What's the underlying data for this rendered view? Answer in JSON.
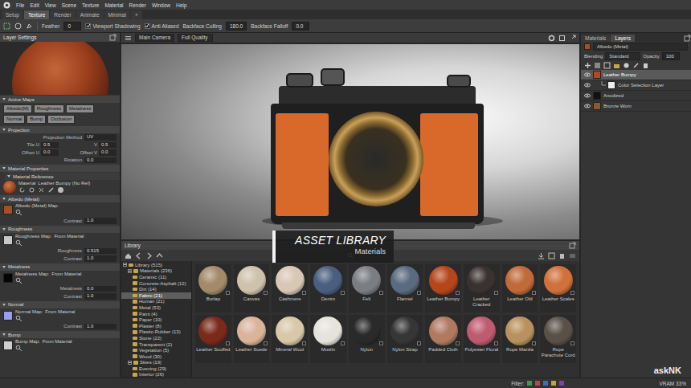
{
  "menu": [
    "File",
    "Edit",
    "View",
    "Scene",
    "Texture",
    "Material",
    "Render",
    "Window",
    "Help"
  ],
  "tabs": [
    {
      "label": "Setup",
      "selected": false
    },
    {
      "label": "Texture",
      "selected": true
    },
    {
      "label": "Render",
      "selected": false
    },
    {
      "label": "Animate",
      "selected": false
    },
    {
      "label": "Minimal",
      "selected": false
    }
  ],
  "tab_add": "+",
  "toolbar": {
    "feather_label": "Feather",
    "feather_value": "0",
    "checks": [
      {
        "label": "Viewport Shadowing",
        "checked": true
      },
      {
        "label": "Anti Aliased",
        "checked": true
      }
    ],
    "culling_label": "Backface Culling",
    "culling_value": "180.0",
    "falloff_label": "Backface Falloff",
    "falloff_value": "0.0"
  },
  "left_panel": {
    "title": "Layer Settings",
    "sections": [
      {
        "title": "Active Maps",
        "rows": [
          {
            "kind": "buttons",
            "buttons": [
              {
                "label": "Albedo(M)",
                "selected": true
              },
              {
                "label": "Roughness",
                "selected": true
              },
              {
                "label": "Metalness",
                "selected": true
              },
              {
                "label": "Normal",
                "selected": true
              },
              {
                "label": "Bump",
                "selected": true
              },
              {
                "label": "Occlusion",
                "selected": true
              }
            ]
          }
        ]
      },
      {
        "title": "Projection",
        "rows": [
          {
            "kind": "field",
            "label": "Projection Method",
            "value": "UV"
          },
          {
            "kind": "pair",
            "items": [
              {
                "label": "Tile U",
                "value": "0.5"
              },
              {
                "label": "V",
                "value": "0.5"
              }
            ]
          },
          {
            "kind": "pair",
            "items": [
              {
                "label": "Offset U",
                "value": "0.0"
              },
              {
                "label": "Offset V",
                "value": "0.0"
              }
            ]
          },
          {
            "kind": "field",
            "label": "Rotation",
            "value": "0.0"
          }
        ]
      },
      {
        "title": "Material Properties",
        "rows": [
          {
            "kind": "subheader",
            "label": "Material Reference"
          },
          {
            "kind": "reference",
            "label": "Material",
            "value": "Leather Bumpy (No Ref)",
            "color": "#9a3e1c"
          }
        ]
      },
      {
        "title": "Albedo (Metal)",
        "rows": [
          {
            "kind": "map",
            "label": "Albedo (Metal) Map:",
            "note": "",
            "color": "#a84e26"
          },
          {
            "kind": "field",
            "label": "Contrast",
            "value": "1.0"
          }
        ]
      },
      {
        "title": "Roughness",
        "rows": [
          {
            "kind": "map",
            "label": "Roughness Map:",
            "note": "From Material",
            "color": "#c8c8c8"
          },
          {
            "kind": "field",
            "label": "Roughness",
            "value": "0.515"
          },
          {
            "kind": "field",
            "label": "Contrast",
            "value": "1.0"
          }
        ]
      },
      {
        "title": "Metalness",
        "rows": [
          {
            "kind": "map",
            "label": "Metalness Map:",
            "note": "From Material",
            "color": "#050505"
          },
          {
            "kind": "field",
            "label": "Metalness",
            "value": "0.0"
          },
          {
            "kind": "field",
            "label": "Contrast",
            "value": "1.0"
          }
        ]
      },
      {
        "title": "Normal",
        "rows": [
          {
            "kind": "map",
            "label": "Normal Map:",
            "note": "From Material",
            "color": "#9a9cf0"
          },
          {
            "kind": "field",
            "label": "Contrast",
            "value": "1.0"
          }
        ]
      },
      {
        "title": "Bump",
        "rows": [
          {
            "kind": "map",
            "label": "Bump Map:",
            "note": "From Material",
            "color": "#cfcfcf"
          }
        ]
      }
    ]
  },
  "viewport": {
    "camera": "Main Camera",
    "quality": "Full Quality"
  },
  "overlay": {
    "title": "ASSET LIBRARY",
    "subtitle": "Materials"
  },
  "library": {
    "title": "Library",
    "tree": [
      {
        "label": "Library (515)",
        "depth": 0,
        "kind": "group",
        "expanded": true,
        "selected": false
      },
      {
        "label": "Materials (236)",
        "depth": 1,
        "kind": "group",
        "expanded": true,
        "selected": false
      },
      {
        "label": "Ceramic (11)",
        "depth": 2,
        "kind": "leaf",
        "selected": false
      },
      {
        "label": "Concrete-Asphalt (12)",
        "depth": 2,
        "kind": "leaf",
        "selected": false
      },
      {
        "label": "Dirt (14)",
        "depth": 2,
        "kind": "leaf",
        "selected": false
      },
      {
        "label": "Fabric (21)",
        "depth": 2,
        "kind": "leaf",
        "selected": true
      },
      {
        "label": "Human (21)",
        "depth": 2,
        "kind": "leaf",
        "selected": false
      },
      {
        "label": "Metal (53)",
        "depth": 2,
        "kind": "leaf",
        "selected": false
      },
      {
        "label": "Paint (4)",
        "depth": 2,
        "kind": "leaf",
        "selected": false
      },
      {
        "label": "Paper (10)",
        "depth": 2,
        "kind": "leaf",
        "selected": false
      },
      {
        "label": "Plaster (8)",
        "depth": 2,
        "kind": "leaf",
        "selected": false
      },
      {
        "label": "Plastic-Rubber (13)",
        "depth": 2,
        "kind": "leaf",
        "selected": false
      },
      {
        "label": "Stone (22)",
        "depth": 2,
        "kind": "leaf",
        "selected": false
      },
      {
        "label": "Transparent (2)",
        "depth": 2,
        "kind": "leaf",
        "selected": false
      },
      {
        "label": "Vegetation (5)",
        "depth": 2,
        "kind": "leaf",
        "selected": false
      },
      {
        "label": "Wood (30)",
        "depth": 2,
        "kind": "leaf",
        "selected": false
      },
      {
        "label": "Skies (19)",
        "depth": 1,
        "kind": "group",
        "expanded": true,
        "selected": false
      },
      {
        "label": "Evening (29)",
        "depth": 2,
        "kind": "leaf",
        "selected": false
      },
      {
        "label": "Interior (26)",
        "depth": 2,
        "kind": "leaf",
        "selected": false
      }
    ],
    "materials": [
      {
        "name": "Burlap",
        "color": "#a38a6b"
      },
      {
        "name": "Canvas",
        "color": "#cfc2ad"
      },
      {
        "name": "Cashmere",
        "color": "#d8c7b5"
      },
      {
        "name": "Denim",
        "color": "#4a5f80"
      },
      {
        "name": "Felt",
        "color": "#7a7d82"
      },
      {
        "name": "Flannel",
        "color": "#5a6a80"
      },
      {
        "name": "Leather Bumpy",
        "color": "#b5461c"
      },
      {
        "name": "Leather Cracked",
        "color": "#3a3230"
      },
      {
        "name": "Leather Old",
        "color": "#c06a3a"
      },
      {
        "name": "Leather Scales",
        "color": "#d0703a"
      },
      {
        "name": "Leather Scuffed",
        "color": "#7a2a1a"
      },
      {
        "name": "Leather Suede",
        "color": "#d9b49a"
      },
      {
        "name": "Mineral Wool",
        "color": "#d8c8a8"
      },
      {
        "name": "Muslin",
        "color": "#e6e3dc"
      },
      {
        "name": "Nylon",
        "color": "#2a2a2a"
      },
      {
        "name": "Nylon Strap",
        "color": "#363636"
      },
      {
        "name": "Padded Cloth",
        "color": "#b07a60"
      },
      {
        "name": "Polyester Floral",
        "color": "#c05a70"
      },
      {
        "name": "Rope Manila",
        "color": "#b8925e"
      },
      {
        "name": "Rope Parachute Cord",
        "color": "#5a5048"
      }
    ]
  },
  "right_panel": {
    "tabs": [
      {
        "label": "Materials",
        "selected": false
      },
      {
        "label": "Layers",
        "selected": true
      }
    ],
    "channel": "Albedo (Metal)",
    "blending_label": "Blending",
    "blending_value": "Standard",
    "opacity_label": "Opacity",
    "opacity_value": "100",
    "layers": [
      {
        "name": "Leather Bumpy",
        "kind": "layer",
        "selected": true,
        "visible": true,
        "color": "#b24a1f"
      },
      {
        "name": "Color Selection Layer",
        "kind": "mask",
        "selected": false,
        "visible": true,
        "color": "#eeeeee"
      },
      {
        "name": "Anodized",
        "kind": "layer",
        "selected": false,
        "visible": true,
        "color": "#111111"
      },
      {
        "name": "Bronze Worn",
        "kind": "layer",
        "selected": false,
        "visible": true,
        "color": "#8a5a30"
      }
    ]
  },
  "status_bar": {
    "filter": "Filter:",
    "filter_colors": [
      "#3d9a4a",
      "#c84040",
      "#3a6fc0",
      "#c8a030",
      "#8a3ab0"
    ],
    "vram": "VRAM 33%"
  },
  "watermark": "askNK"
}
